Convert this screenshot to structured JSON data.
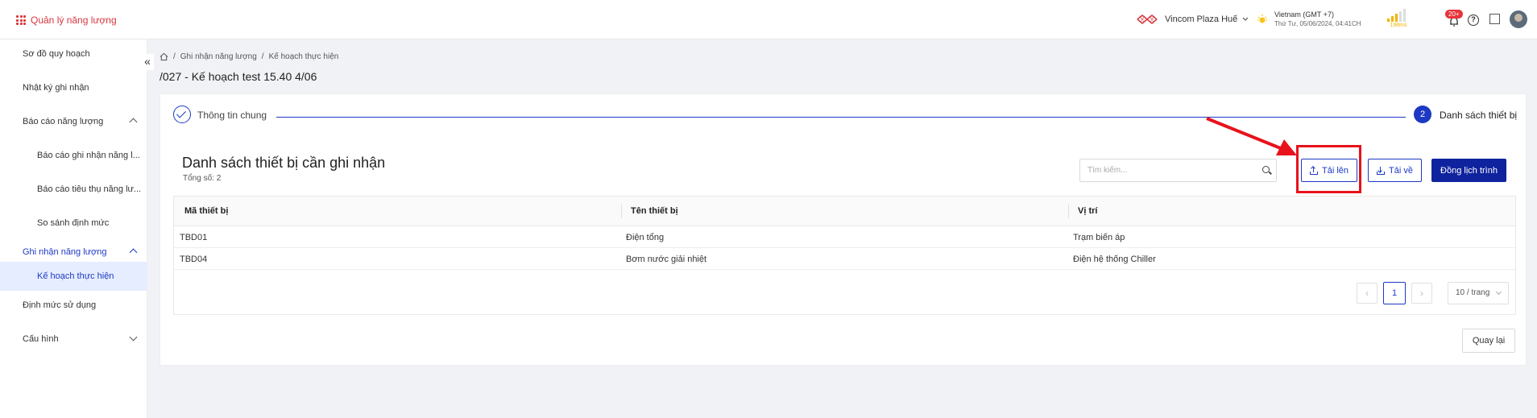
{
  "header": {
    "app_title": "Quản lý năng lượng",
    "site_name": "Vincom Plaza Huế",
    "timezone": "Vietnam (GMT +7)",
    "datetime": "Thứ Tư, 05/06/2024, 04:41CH",
    "signal_label": "198ms",
    "notification_count": "20+",
    "colors": {
      "brand": "#d9363e",
      "accent": "#1d39c4"
    }
  },
  "sidebar": {
    "items": [
      {
        "label": "Sơ đồ quy hoạch"
      },
      {
        "label": "Nhật ký ghi nhận"
      },
      {
        "label": "Báo cáo năng lượng"
      },
      {
        "label": "Báo cáo ghi nhận năng l..."
      },
      {
        "label": "Báo cáo tiêu thụ năng lư..."
      },
      {
        "label": "So sánh định mức"
      },
      {
        "label": "Ghi nhận năng lượng"
      },
      {
        "label": "Kế hoạch thực hiện"
      },
      {
        "label": "Định mức sử dụng"
      },
      {
        "label": "Cấu hình"
      }
    ],
    "collapse_glyph": "«"
  },
  "breadcrumb": {
    "items": [
      "Ghi nhận năng lượng",
      "Kế hoạch thực hiện"
    ],
    "separator": "/"
  },
  "page_title": "/027 - Kế hoạch test 15.40 4/06",
  "stepper": {
    "step1_label": "Thông tin chung",
    "step2_number": "2",
    "step2_label": "Danh sách thiết bị"
  },
  "list": {
    "title": "Danh sách thiết bị cần ghi nhận",
    "total_label": "Tổng số: 2",
    "search_placeholder": "Tìm kiếm...",
    "upload_label": "Tải lên",
    "download_label": "Tải về",
    "sync_label": "Đồng lịch trình"
  },
  "table": {
    "columns": [
      "Mã thiết bị",
      "Tên thiết bị",
      "Vị trí"
    ],
    "rows": [
      [
        "TBD01",
        "Điện tổng",
        "Trạm biến áp"
      ],
      [
        "TBD04",
        "Bơm nước giải nhiệt",
        "Điện hệ thống Chiller"
      ]
    ]
  },
  "pagination": {
    "prev": "‹",
    "current_page": "1",
    "next": "›",
    "page_size": "10 / trang"
  },
  "back_label": "Quay lại"
}
